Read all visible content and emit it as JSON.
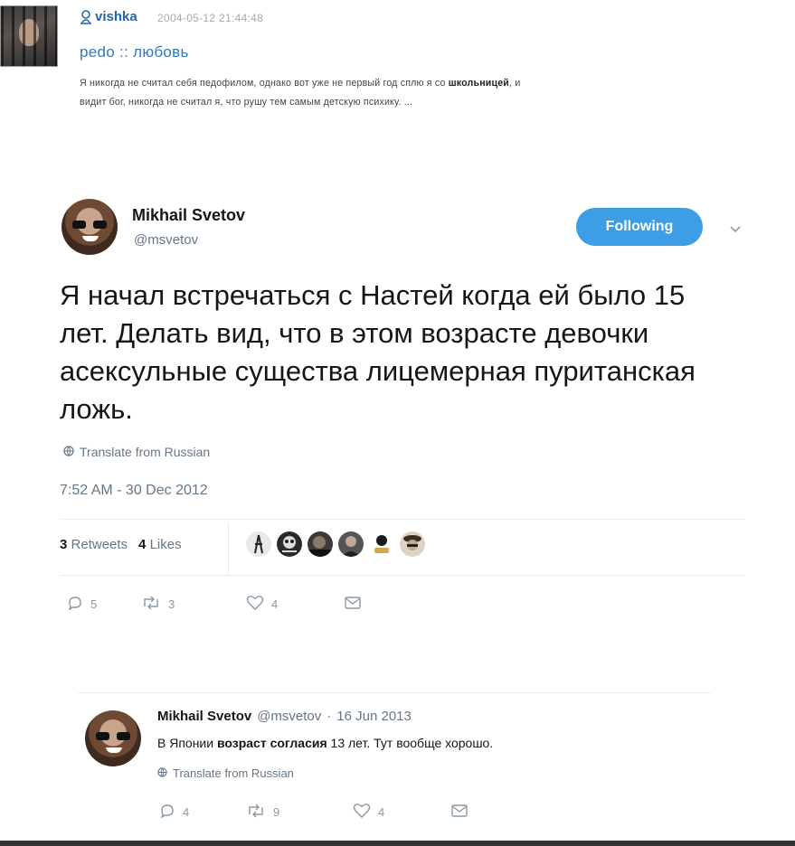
{
  "lj": {
    "username": "vishka",
    "datetime": "2004-05-12 21:44:48",
    "subject": "pedo :: любовь",
    "excerpt_line1_before": "Я никогда не считал себя педофилом, однако вот уже не первый год сплю я со ",
    "excerpt_line1_bold": "школьницей",
    "excerpt_line1_after": ", и",
    "excerpt_line2": "видит бог, никогда не считал я, что рушу тем самым детскую психику. ..."
  },
  "tweet": {
    "name": "Mikhail Svetov",
    "handle": "@msvetov",
    "follow_label": "Following",
    "text": "Я начал встречаться с Настей когда ей было 15 лет. Делать вид, что в этом возрасте девочки асексульные существа лицемерная пуританская ложь.",
    "translate_label": "Translate from Russian",
    "timestamp": "7:52 AM - 30 Dec 2012",
    "retweets_count": "3",
    "retweets_label": "Retweets",
    "likes_count": "4",
    "likes_label": "Likes",
    "actions": {
      "replies": "5",
      "retweets": "3",
      "likes": "4"
    }
  },
  "reply": {
    "name": "Mikhail Svetov",
    "handle": "@msvetov",
    "separator": "·",
    "date": "16 Jun 2013",
    "text_before": "В Японии ",
    "text_bold": "возраст согласия",
    "text_after": " 13 лет. Тут вообще хорошо.",
    "translate_label": "Translate from Russian",
    "actions": {
      "replies": "4",
      "retweets": "9",
      "likes": "4"
    }
  },
  "colors": {
    "accent": "#3d9ee6",
    "lj_link": "#3377bb",
    "muted": "#657786"
  }
}
